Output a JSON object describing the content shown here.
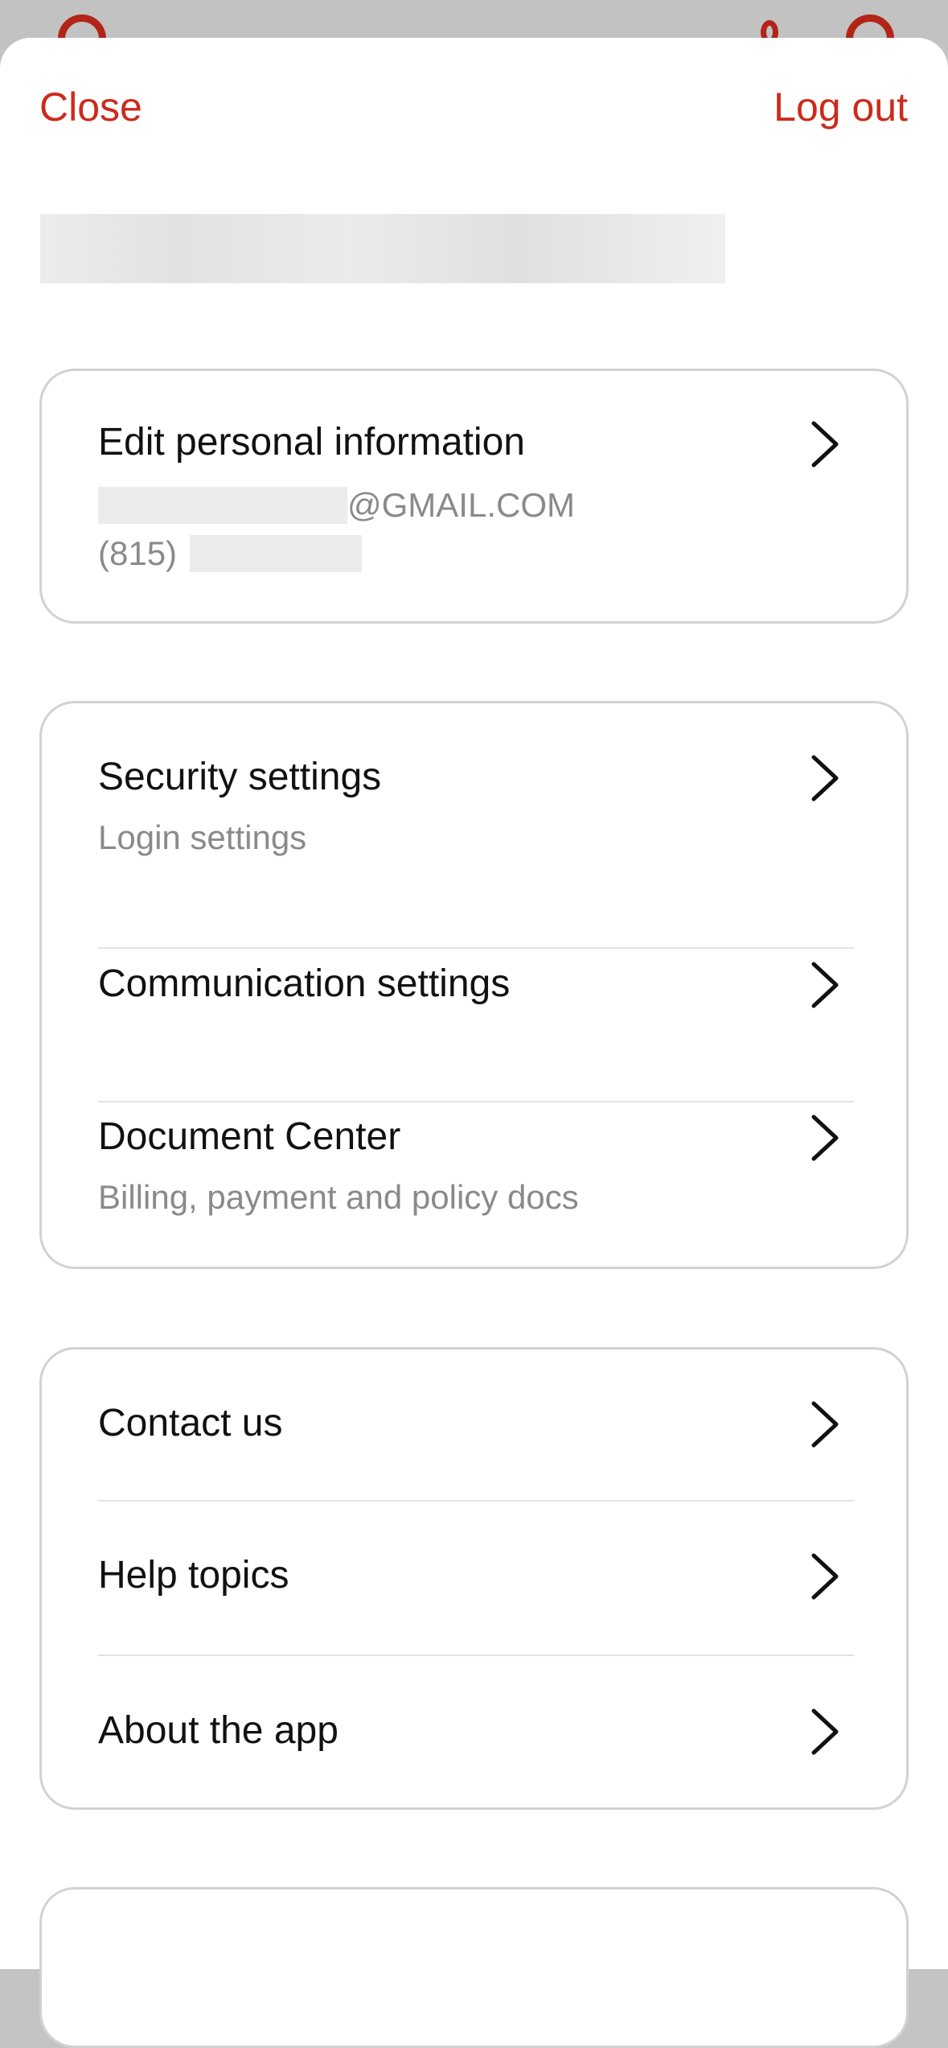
{
  "header": {
    "close_label": "Close",
    "logout_label": "Log out"
  },
  "profile": {
    "title": "Edit personal information",
    "email_suffix": "@GMAIL.COM",
    "phone_prefix": "(815)"
  },
  "settings": {
    "items": [
      {
        "title": "Security settings",
        "subtitle": "Login settings"
      },
      {
        "title": "Communication settings",
        "subtitle": ""
      },
      {
        "title": "Document Center",
        "subtitle": "Billing, payment and policy docs"
      }
    ]
  },
  "help": {
    "items": [
      {
        "title": "Contact us"
      },
      {
        "title": "Help topics"
      },
      {
        "title": "About the app"
      }
    ]
  },
  "colors": {
    "accent": "#cc2a1c",
    "text": "#111111",
    "secondary_text": "#8a8a8a",
    "card_border": "#d2d2d2"
  },
  "icons": {
    "row_chevron": "chevron-right-icon"
  }
}
